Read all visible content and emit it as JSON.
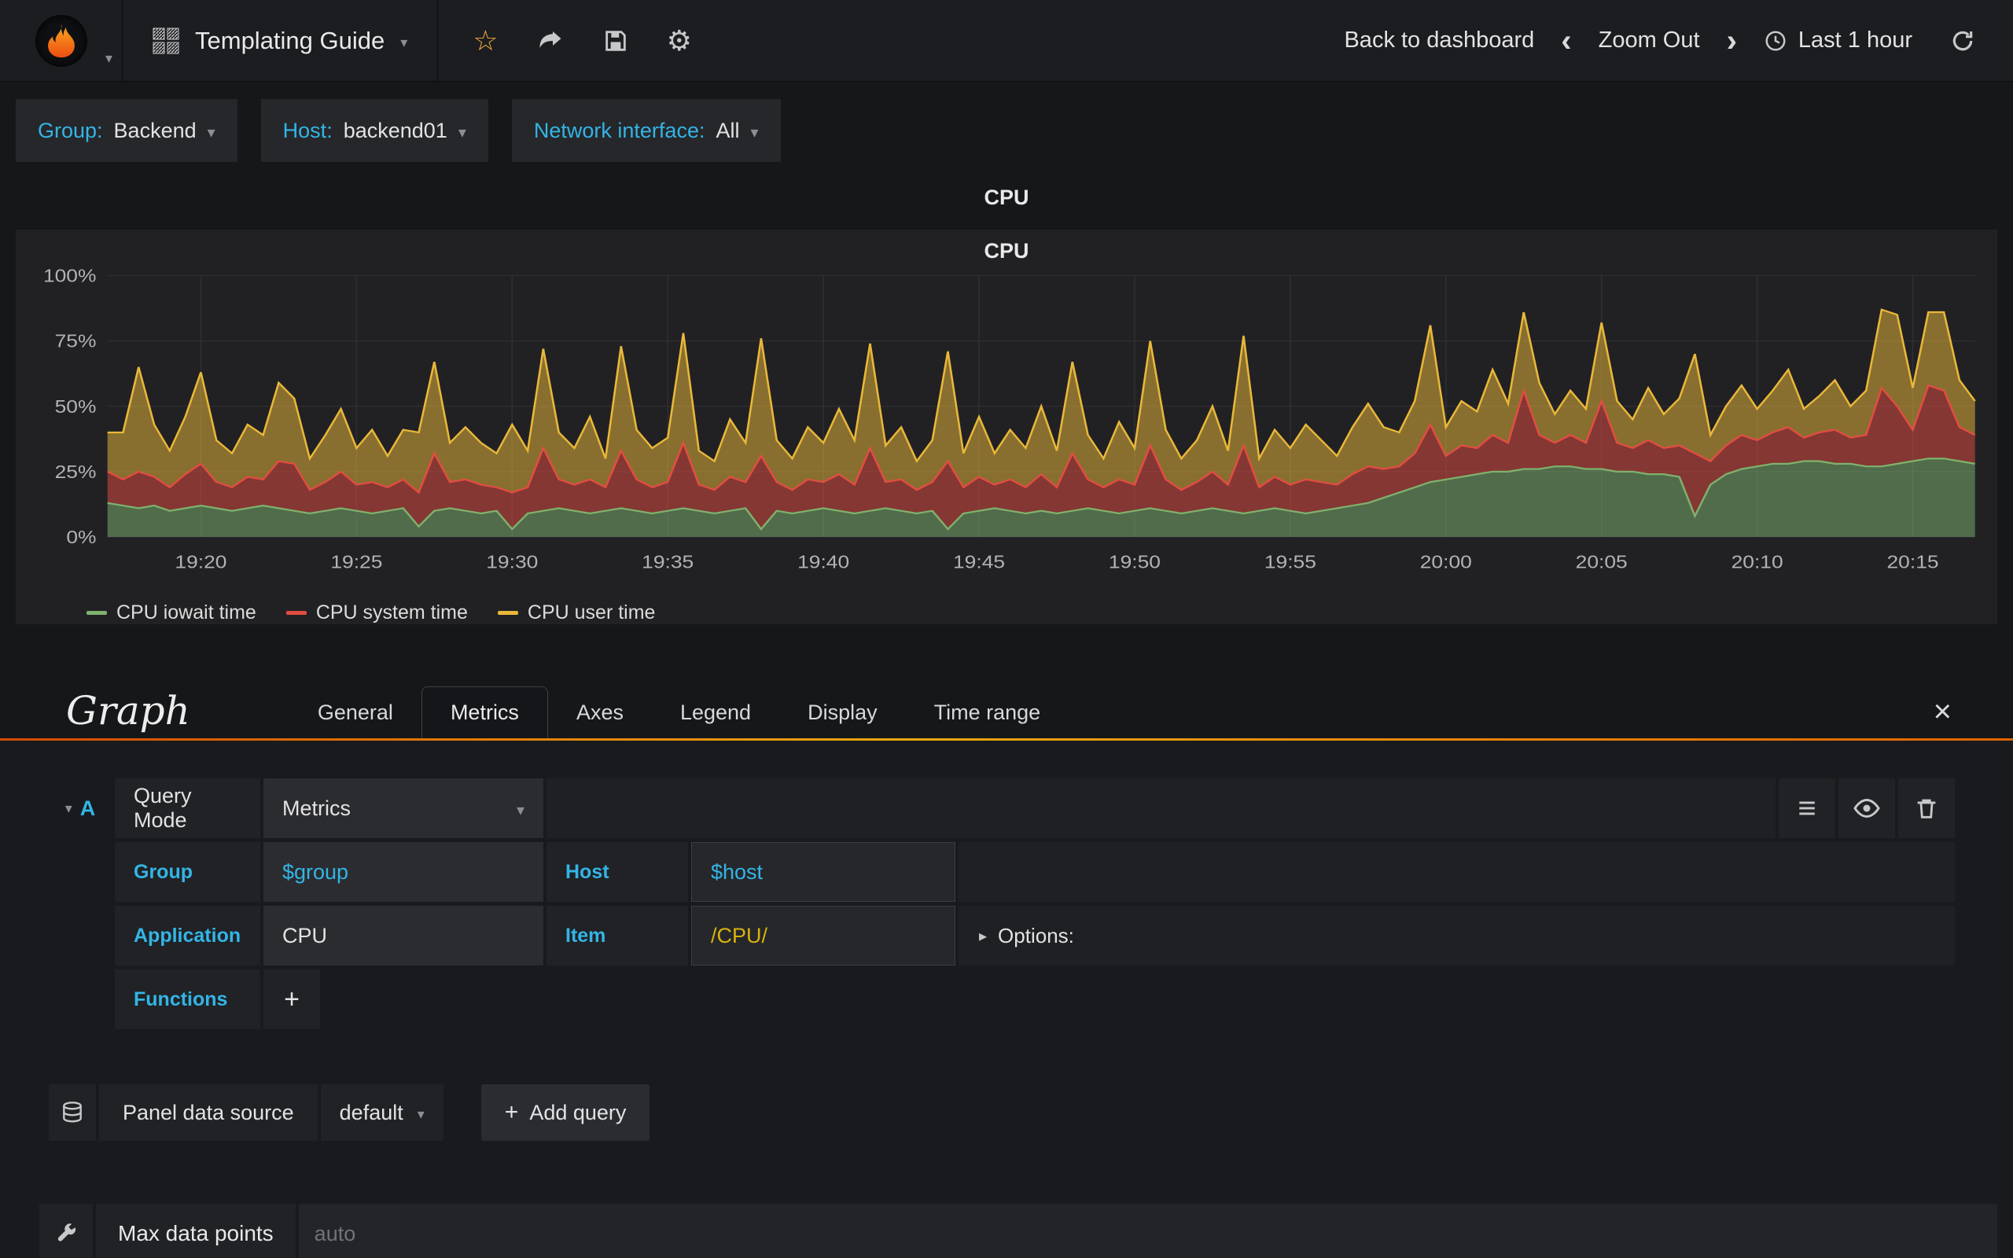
{
  "navbar": {
    "title": "Templating Guide",
    "back_to_dashboard": "Back to dashboard",
    "zoom_out": "Zoom Out",
    "time_range": "Last 1 hour"
  },
  "icons": {
    "caret_down": "▾",
    "caret_right": "▸",
    "plus": "+",
    "close": "×",
    "menu": "≡",
    "star": "☆",
    "gear": "⚙",
    "chevron_left": "‹",
    "chevron_right": "›"
  },
  "variables": [
    {
      "label": "Group:",
      "value": "Backend"
    },
    {
      "label": "Host:",
      "value": "backend01"
    },
    {
      "label": "Network interface:",
      "value": "All"
    }
  ],
  "panel": {
    "title": "CPU",
    "inner_title": "CPU"
  },
  "chart_data": {
    "type": "area",
    "stacked": true,
    "title": "CPU",
    "ylim": [
      0,
      100
    ],
    "y_ticks": [
      "0%",
      "25%",
      "50%",
      "75%",
      "100%"
    ],
    "x_ticks": [
      "19:20",
      "19:25",
      "19:30",
      "19:35",
      "19:40",
      "19:45",
      "19:50",
      "19:55",
      "20:00",
      "20:05",
      "20:10",
      "20:15"
    ],
    "x_tick_indices": [
      6,
      16,
      26,
      36,
      46,
      56,
      66,
      76,
      86,
      96,
      106,
      116
    ],
    "legend_position": "bottom-left",
    "grid": true,
    "series": [
      {
        "name": "CPU iowait time",
        "color": "#7EB26D",
        "values": [
          13,
          12,
          11,
          12,
          10,
          11,
          12,
          11,
          10,
          11,
          12,
          11,
          10,
          9,
          10,
          11,
          10,
          9,
          10,
          11,
          4,
          10,
          11,
          10,
          9,
          10,
          3,
          9,
          10,
          11,
          10,
          9,
          10,
          11,
          10,
          9,
          10,
          11,
          10,
          9,
          10,
          11,
          3,
          10,
          9,
          10,
          11,
          10,
          9,
          10,
          11,
          10,
          9,
          10,
          3,
          9,
          10,
          11,
          10,
          9,
          10,
          9,
          10,
          11,
          10,
          9,
          10,
          11,
          10,
          9,
          10,
          11,
          10,
          9,
          10,
          11,
          10,
          9,
          10,
          11,
          12,
          13,
          15,
          17,
          19,
          21,
          22,
          23,
          24,
          25,
          25,
          26,
          26,
          27,
          27,
          26,
          26,
          25,
          25,
          24,
          24,
          23,
          8,
          20,
          24,
          26,
          27,
          28,
          28,
          29,
          29,
          28,
          28,
          27,
          27,
          28,
          29,
          30,
          30,
          29,
          28
        ]
      },
      {
        "name": "CPU system time",
        "color": "#E24D42",
        "values": [
          12,
          10,
          14,
          11,
          9,
          13,
          16,
          10,
          9,
          12,
          10,
          18,
          18,
          9,
          11,
          14,
          10,
          12,
          9,
          11,
          13,
          22,
          10,
          12,
          11,
          9,
          14,
          10,
          24,
          11,
          10,
          13,
          9,
          22,
          12,
          10,
          11,
          25,
          10,
          9,
          13,
          10,
          28,
          11,
          9,
          12,
          10,
          14,
          11,
          24,
          10,
          12,
          9,
          11,
          26,
          10,
          13,
          9,
          12,
          10,
          14,
          10,
          22,
          11,
          9,
          13,
          10,
          24,
          12,
          9,
          11,
          14,
          10,
          26,
          9,
          12,
          10,
          13,
          11,
          9,
          12,
          14,
          11,
          10,
          13,
          22,
          9,
          12,
          10,
          14,
          11,
          30,
          13,
          9,
          12,
          10,
          26,
          11,
          9,
          13,
          10,
          12,
          24,
          9,
          11,
          13,
          10,
          12,
          14,
          9,
          11,
          13,
          10,
          12,
          30,
          22,
          12,
          28,
          26,
          13,
          11
        ]
      },
      {
        "name": "CPU user time",
        "color": "#EAB839",
        "values": [
          15,
          18,
          40,
          20,
          14,
          22,
          35,
          16,
          13,
          20,
          17,
          30,
          25,
          12,
          18,
          24,
          14,
          20,
          12,
          19,
          23,
          35,
          15,
          20,
          16,
          13,
          26,
          14,
          38,
          18,
          14,
          24,
          11,
          40,
          19,
          15,
          17,
          42,
          13,
          11,
          22,
          15,
          45,
          16,
          12,
          20,
          15,
          25,
          17,
          40,
          14,
          20,
          11,
          16,
          42,
          13,
          23,
          12,
          19,
          15,
          26,
          14,
          35,
          17,
          11,
          22,
          14,
          40,
          19,
          12,
          16,
          25,
          13,
          42,
          11,
          18,
          14,
          21,
          16,
          11,
          18,
          24,
          16,
          13,
          20,
          38,
          11,
          17,
          14,
          25,
          15,
          30,
          20,
          11,
          17,
          13,
          30,
          16,
          11,
          20,
          13,
          18,
          38,
          10,
          15,
          19,
          12,
          16,
          22,
          11,
          14,
          19,
          12,
          17,
          30,
          35,
          16,
          28,
          30,
          18,
          13
        ]
      }
    ]
  },
  "editor": {
    "panel_type_title": "Graph",
    "tabs": [
      "General",
      "Metrics",
      "Axes",
      "Legend",
      "Display",
      "Time range"
    ],
    "active_tab": "Metrics",
    "query": {
      "letter": "A",
      "mode_label": "Query Mode",
      "mode_value": "Metrics",
      "group_label": "Group",
      "group_value": "$group",
      "host_label": "Host",
      "host_value": "$host",
      "application_label": "Application",
      "application_value": "CPU",
      "item_label": "Item",
      "item_value": "/CPU/",
      "options_label": "Options:",
      "functions_label": "Functions"
    },
    "datasource": {
      "label": "Panel data source",
      "value": "default",
      "add_query_label": "Add query"
    },
    "max_data_points": {
      "label": "Max data points",
      "placeholder": "auto"
    }
  }
}
